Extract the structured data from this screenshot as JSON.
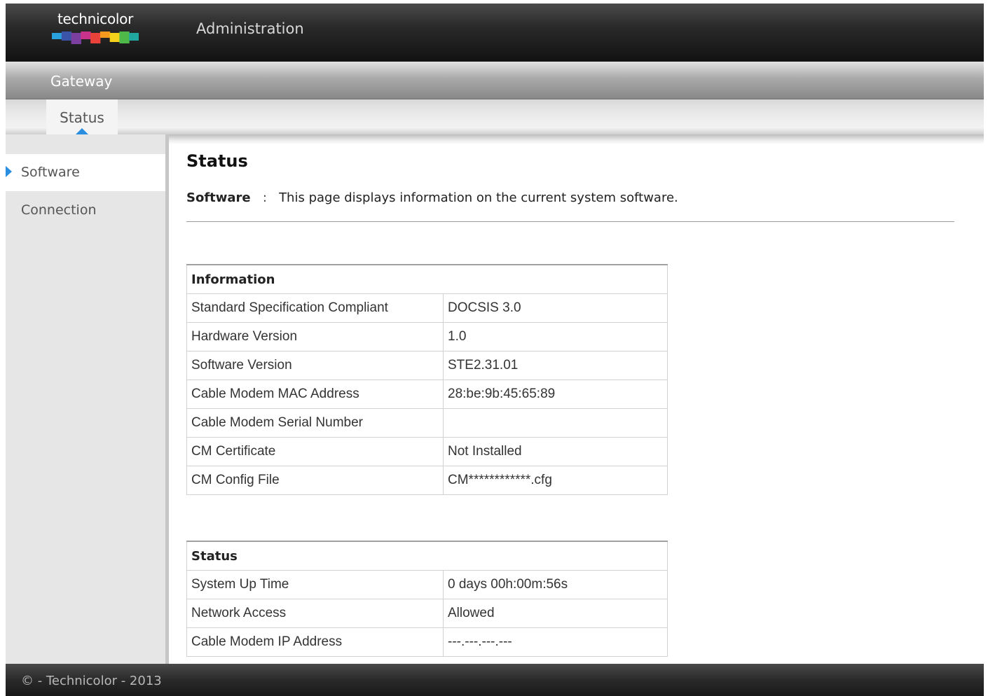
{
  "header": {
    "logo_text": "technicolor",
    "logo_colors": [
      "#2aa0dc",
      "#3a54a8",
      "#7b3fa0",
      "#c8328a",
      "#e8423a",
      "#f39a1e",
      "#f4d21c",
      "#4eb848",
      "#1fa7a0"
    ],
    "title": "Administration"
  },
  "nav": {
    "section": "Gateway",
    "tab": "Status"
  },
  "sidebar": {
    "items": [
      {
        "label": "Software",
        "active": true
      },
      {
        "label": "Connection",
        "active": false
      }
    ]
  },
  "main": {
    "title": "Status",
    "desc_label": "Software",
    "desc_sep": ":",
    "desc_text": "This page displays information on the current system software."
  },
  "information": {
    "header": "Information",
    "rows": [
      {
        "label": "Standard Specification Compliant",
        "value": "DOCSIS 3.0"
      },
      {
        "label": "Hardware Version",
        "value": "1.0"
      },
      {
        "label": "Software Version",
        "value": "STE2.31.01"
      },
      {
        "label": "Cable Modem MAC Address",
        "value": "28:be:9b:45:65:89"
      },
      {
        "label": "Cable Modem Serial Number",
        "value": ""
      },
      {
        "label": "CM Certificate",
        "value": "Not Installed"
      },
      {
        "label": "CM Config File",
        "value": "CM************.cfg"
      }
    ]
  },
  "status": {
    "header": "Status",
    "rows": [
      {
        "label": "System Up Time",
        "value": "0 days 00h:00m:56s"
      },
      {
        "label": "Network Access",
        "value": "Allowed"
      },
      {
        "label": "Cable Modem IP Address",
        "value": "---.---.---.---"
      }
    ]
  },
  "footer": {
    "text": "© - Technicolor - 2013"
  },
  "colors": {
    "accent": "#2a8ee0"
  }
}
